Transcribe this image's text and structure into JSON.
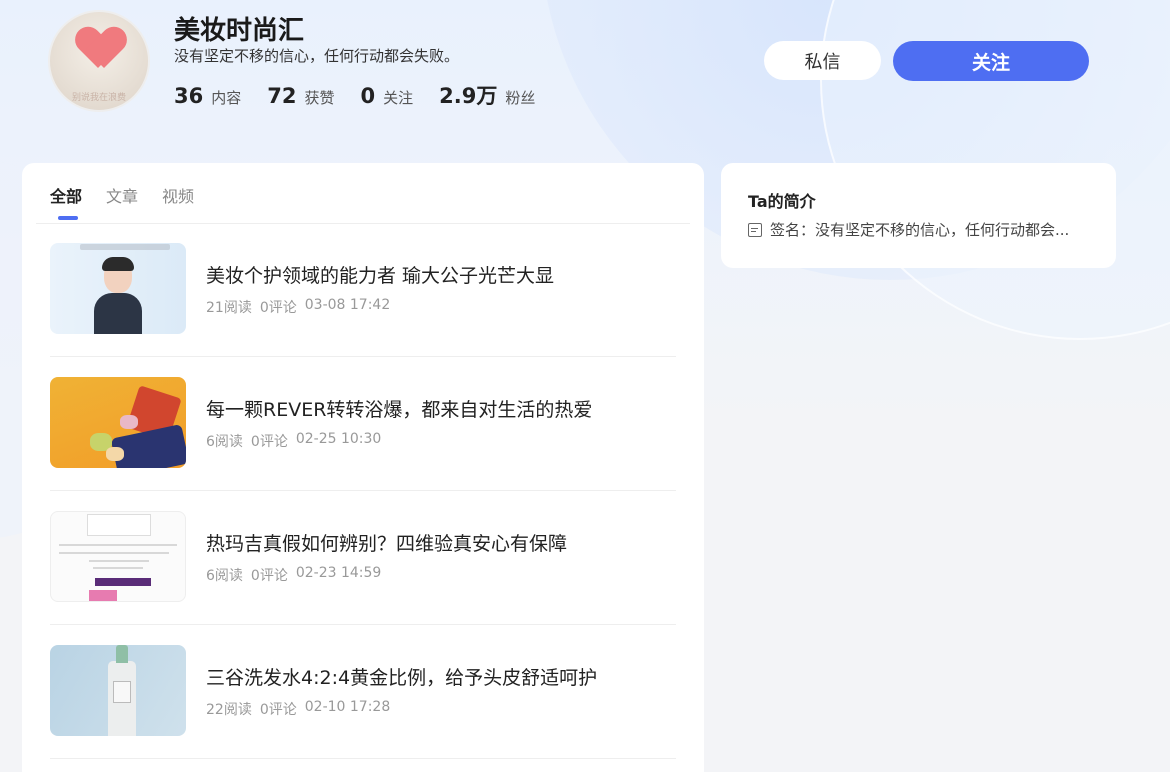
{
  "profile": {
    "name": "美妆时尚汇",
    "signature": "没有坚定不移的信心，任何行动都会失败。",
    "avatar_caption": "别说我在浪费",
    "stats": [
      {
        "value": "36",
        "label": "内容"
      },
      {
        "value": "72",
        "label": "获赞"
      },
      {
        "value": "0",
        "label": "关注"
      },
      {
        "value": "2.9万",
        "label": "粉丝"
      }
    ],
    "message_label": "私信",
    "follow_label": "关注",
    "accent_color": "#4e6ef2"
  },
  "tabs": [
    {
      "label": "全部",
      "active": true
    },
    {
      "label": "文章",
      "active": false
    },
    {
      "label": "视频",
      "active": false
    }
  ],
  "articles": [
    {
      "title": "美妆个护领域的能力者 瑜大公子光芒大显",
      "reads": "21阅读",
      "comments": "0评论",
      "time": "03-08 17:42"
    },
    {
      "title": "每一颗REVER转转浴爆，都来自对生活的热爱",
      "reads": "6阅读",
      "comments": "0评论",
      "time": "02-25 10:30"
    },
    {
      "title": "热玛吉真假如何辨别？四维验真安心有保障",
      "reads": "6阅读",
      "comments": "0评论",
      "time": "02-23 14:59"
    },
    {
      "title": "三谷洗发水4:2:4黄金比例，给予头皮舒适呵护",
      "reads": "22阅读",
      "comments": "0评论",
      "time": "02-10 17:28"
    }
  ],
  "intro": {
    "heading": "Ta的简介",
    "signature_text": "签名：没有坚定不移的信心，任何行动都会..."
  }
}
